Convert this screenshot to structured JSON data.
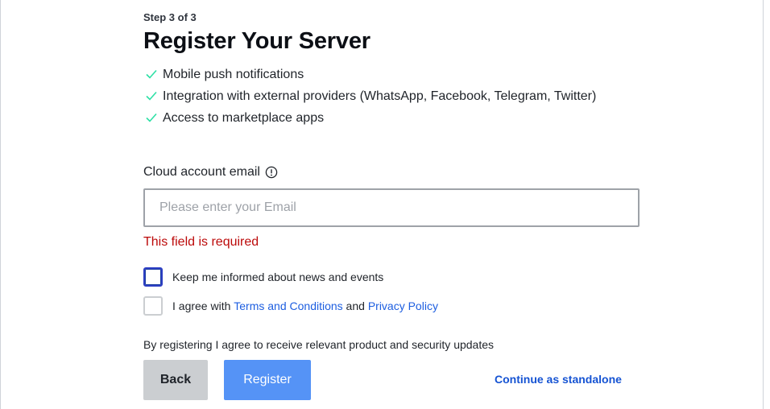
{
  "step_label": "Step 3 of 3",
  "title": "Register Your Server",
  "features": [
    "Mobile push notifications",
    "Integration with external providers (WhatsApp, Facebook, Telegram, Twitter)",
    "Access to marketplace apps"
  ],
  "email": {
    "label": "Cloud account email",
    "placeholder": "Please enter your Email",
    "value": "",
    "error": "This field is required"
  },
  "checkboxes": {
    "news_label": "Keep me informed about news and events",
    "agree_prefix": "I agree with ",
    "terms_link": "Terms and Conditions",
    "agree_and": " and ",
    "privacy_link": "Privacy Policy"
  },
  "note": "By registering I agree to receive relevant product and security updates",
  "buttons": {
    "back": "Back",
    "register": "Register",
    "standalone": "Continue as standalone"
  },
  "colors": {
    "error": "#bc0a0a",
    "link": "#1d5ee0",
    "register_bg": "#5593f6",
    "back_bg": "#cbced1",
    "check": "#2de0a5"
  },
  "icons": {
    "feature_check": "check-icon",
    "info": "info-icon"
  }
}
